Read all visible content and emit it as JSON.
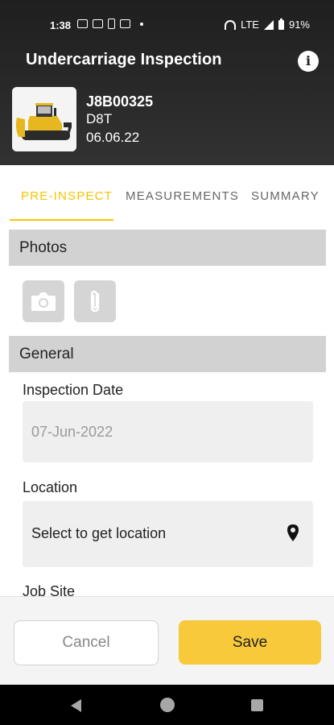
{
  "status_bar": {
    "time": "1:38",
    "network": "LTE",
    "battery": "91%",
    "icons": [
      "notification-icon",
      "notification-icon",
      "phone-icon",
      "calendar-icon",
      "dot-icon",
      "hotspot-icon",
      "signal-icon",
      "battery-icon"
    ]
  },
  "app_bar": {
    "title": "Undercarriage Inspection",
    "info_icon": "info-icon"
  },
  "machine": {
    "serial": "J8B00325",
    "model": "D8T",
    "date": "06.06.22",
    "image": "bulldozer-image"
  },
  "tabs": [
    {
      "label": "PRE-INSPECT",
      "active": true
    },
    {
      "label": "MEASUREMENTS",
      "active": false
    },
    {
      "label": "SUMMARY",
      "active": false
    }
  ],
  "sections": {
    "photos": {
      "title": "Photos",
      "buttons": [
        "camera-icon",
        "paperclip-icon"
      ]
    },
    "general": {
      "title": "General",
      "fields": {
        "inspection_date": {
          "label": "Inspection Date",
          "value": "07-Jun-2022"
        },
        "location": {
          "label": "Location",
          "value": "Select to get location",
          "icon": "location-pin-icon"
        },
        "job_site": {
          "label": "Job Site"
        }
      }
    }
  },
  "actions": {
    "cancel_label": "Cancel",
    "save_label": "Save"
  },
  "colors": {
    "accent": "#f5c400",
    "save_button": "#f7c93b",
    "section_bar": "#d2d2d2",
    "header_bg": "#2a2a2a"
  }
}
